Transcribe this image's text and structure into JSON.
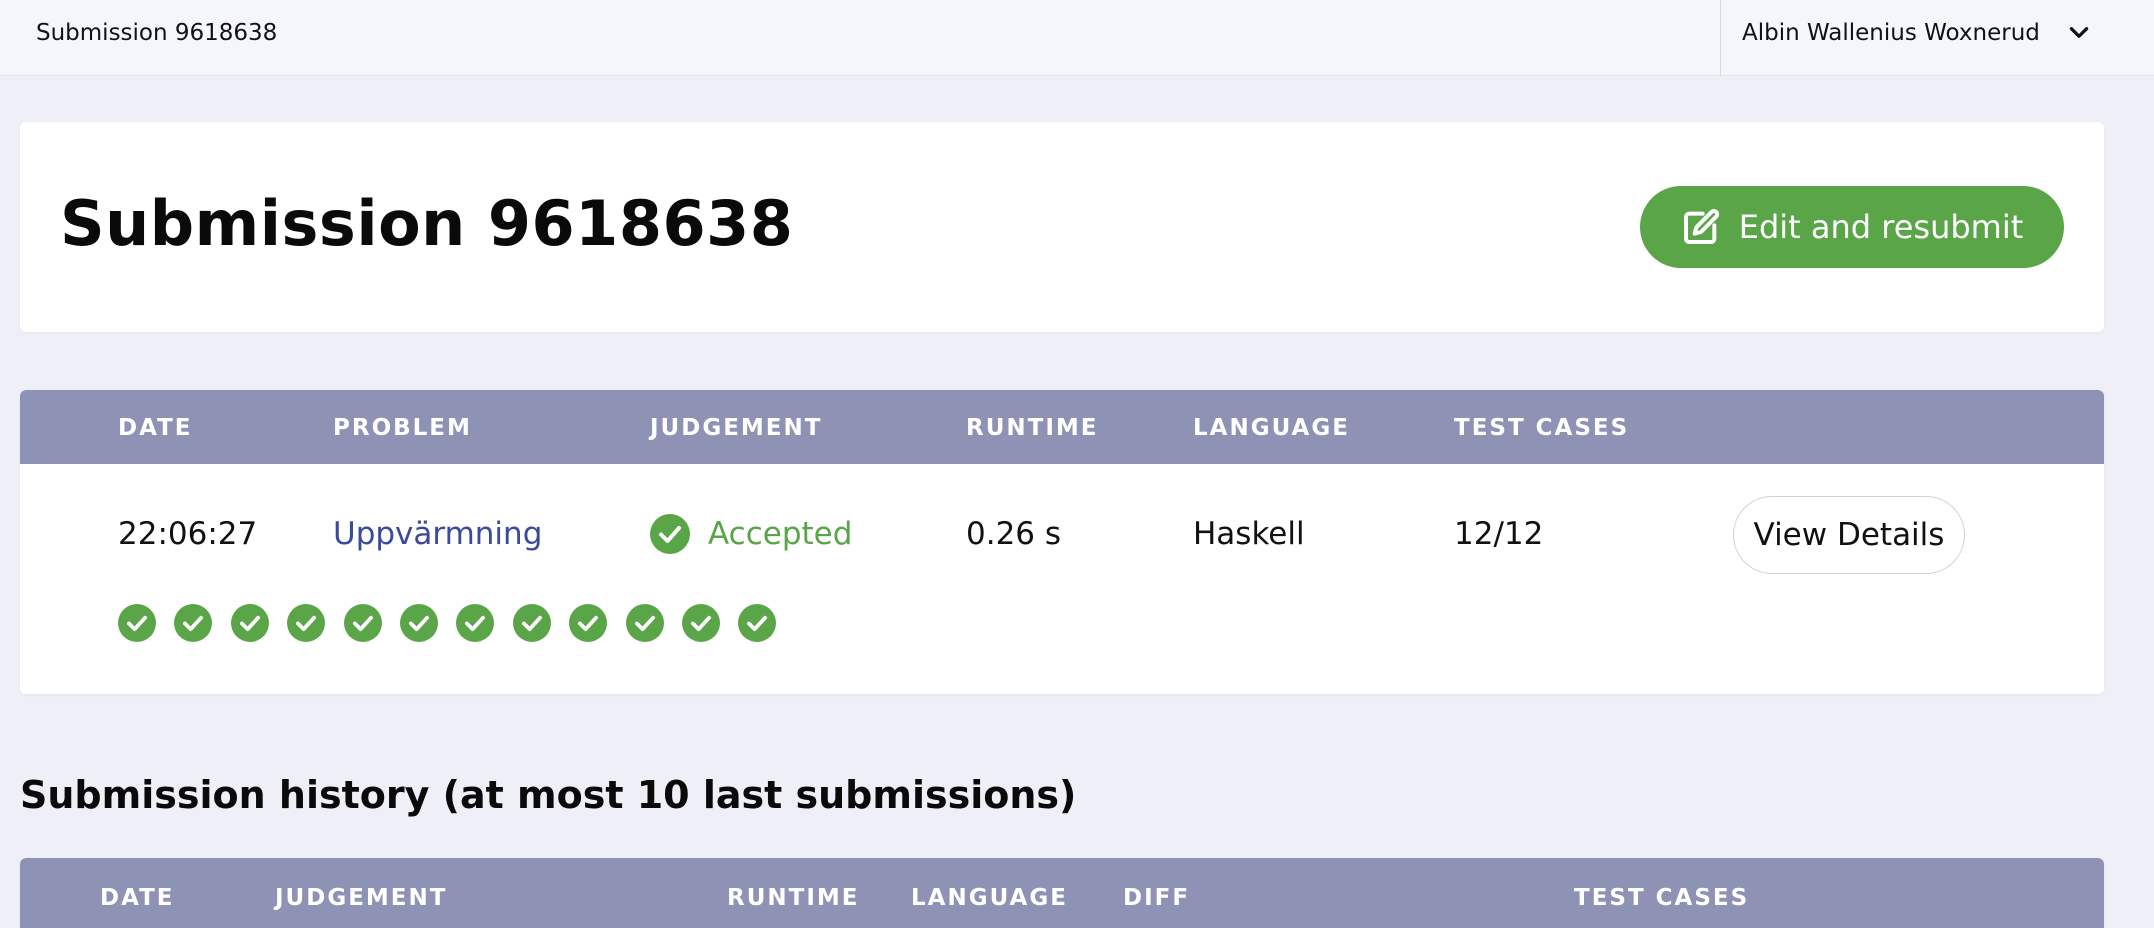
{
  "topbar": {
    "title": "Submission 9618638",
    "user_name": "Albin Wallenius Woxnerud",
    "chevron_icon": "chevron-down-icon"
  },
  "header": {
    "title": "Submission 9618638",
    "resubmit_label": "Edit and resubmit",
    "resubmit_icon": "edit-icon",
    "accent_color": "#5aa548"
  },
  "submission_table": {
    "columns": [
      "DATE",
      "PROBLEM",
      "JUDGEMENT",
      "RUNTIME",
      "LANGUAGE",
      "TEST CASES"
    ],
    "row": {
      "date": "22:06:27",
      "problem": "Uppvärmning",
      "judgement": "Accepted",
      "runtime": "0.26 s",
      "language": "Haskell",
      "test_cases": "12/12",
      "view_details_label": "View Details"
    },
    "test_case_results": [
      "passed",
      "passed",
      "passed",
      "passed",
      "passed",
      "passed",
      "passed",
      "passed",
      "passed",
      "passed",
      "passed",
      "passed"
    ],
    "header_color": "#8e92b5"
  },
  "history": {
    "title": "Submission history (at most 10 last submissions)",
    "columns": [
      "DATE",
      "JUDGEMENT",
      "RUNTIME",
      "LANGUAGE",
      "DIFF",
      "TEST CASES"
    ]
  }
}
